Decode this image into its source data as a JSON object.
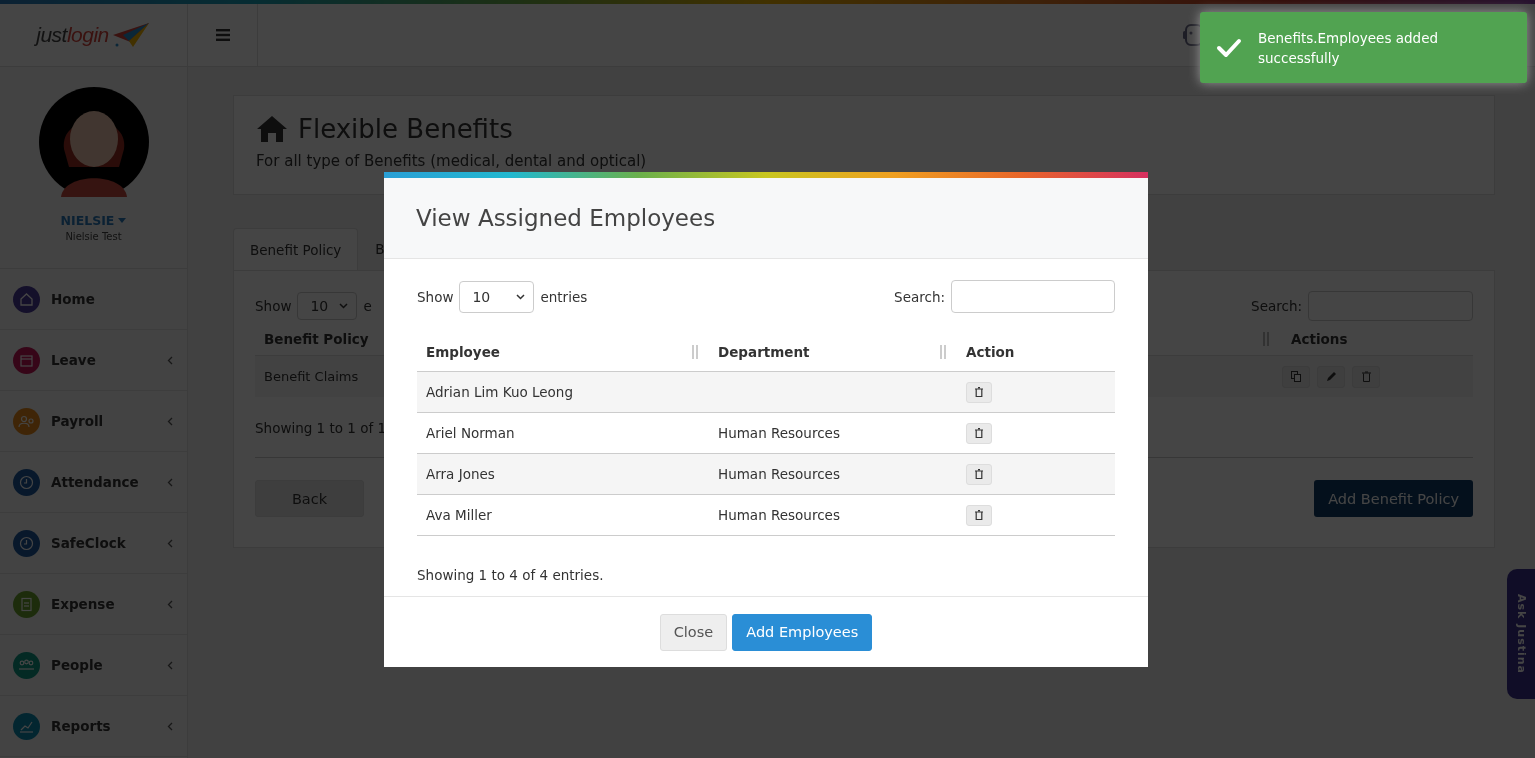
{
  "app": {
    "logo": [
      "just",
      "login"
    ]
  },
  "profile": {
    "name": "NIELSIE",
    "full_name": "Nielsie Test"
  },
  "menu": [
    {
      "label": "Home",
      "has_submenu": false
    },
    {
      "label": "Leave",
      "has_submenu": true
    },
    {
      "label": "Payroll",
      "has_submenu": true
    },
    {
      "label": "Attendance",
      "has_submenu": true
    },
    {
      "label": "SafeClock",
      "has_submenu": true
    },
    {
      "label": "Expense",
      "has_submenu": true
    },
    {
      "label": "People",
      "has_submenu": true
    },
    {
      "label": "Reports",
      "has_submenu": true
    }
  ],
  "page": {
    "title": "Flexible Benefits",
    "subtitle": "For all type of Benefits (medical, dental and optical)",
    "tabs": [
      {
        "label": "Benefit Policy",
        "selected": true
      },
      {
        "label": "B",
        "selected": false
      }
    ],
    "show_label": "Show",
    "page_size": "10",
    "entries_label": "e",
    "search_label": "Search:",
    "columns": [
      "Benefit Policy",
      "Actions"
    ],
    "rows": [
      {
        "name": "Benefit Claims"
      }
    ],
    "info": "Showing 1 to 1 of 1",
    "back": "Back",
    "add": "Add Benefit Policy"
  },
  "assistant_tab": "Ask Justina",
  "modal": {
    "title": "View Assigned Employees",
    "show_label": "Show",
    "page_size": "10",
    "entries_label": "entries",
    "search_label": "Search:",
    "columns": [
      {
        "label": "Employee",
        "sortable": true
      },
      {
        "label": "Department",
        "sortable": true
      },
      {
        "label": "Action",
        "sortable": false
      }
    ],
    "rows": [
      {
        "employee": "Adrian Lim Kuo Leong"
      },
      {
        "employee": "Ariel Norman",
        "department": "Human Resources"
      },
      {
        "employee": "Arra Jones",
        "department": "Human Resources"
      },
      {
        "employee": "Ava Miller",
        "department": "Human Resources"
      }
    ],
    "info": "Showing 1 to 4 of 4 entries.",
    "buttons": [
      {
        "label": "Close",
        "kind": "default"
      },
      {
        "label": "Add Employees",
        "kind": "primary"
      }
    ]
  },
  "toast": {
    "message": "Benefits.Employees added successfully"
  }
}
